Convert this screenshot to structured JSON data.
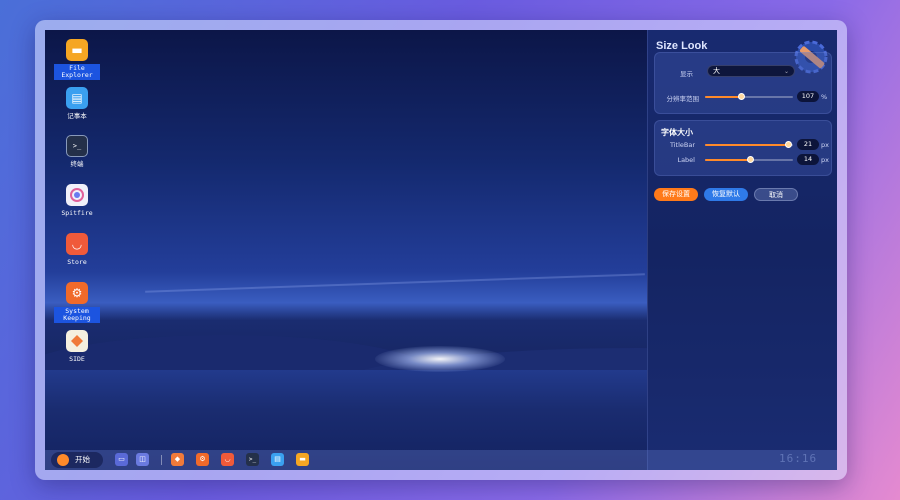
{
  "desktop": {
    "icons": [
      {
        "label": "File Explorer",
        "icon": "folder-icon",
        "color": "#f5a623"
      },
      {
        "label": "记事本",
        "icon": "notepad-icon",
        "color": "#3aa0f0"
      },
      {
        "label": "终端",
        "icon": "terminal-icon",
        "color": "#24304a"
      },
      {
        "label": "Spitfire",
        "icon": "browser-icon",
        "color": "#e8e8f8"
      },
      {
        "label": "Store",
        "icon": "store-icon",
        "color": "#f05a3a"
      },
      {
        "label": "System Keeping",
        "icon": "settings-icon",
        "color": "#f06a2a"
      },
      {
        "label": "SIDE",
        "icon": "ide-icon",
        "color": "#f5f0e0"
      }
    ]
  },
  "panel": {
    "title": "Size Look",
    "display_label": "显示",
    "display_value": "大",
    "resolution_label": "分辨率范围",
    "resolution_value": "107",
    "resolution_level": 0.42,
    "resolution_unit": "%",
    "font_section_title": "字体大小",
    "titlebar_label": "TitleBar",
    "titlebar_value": "21",
    "titlebar_level": 0.95,
    "label_label": "Label",
    "label_value": "14",
    "label_level": 0.52,
    "unit_px": "px",
    "save_button": "保存设置",
    "restore_button": "恢复默认",
    "cancel_button": "取消",
    "accent_color": "#ff8a2a",
    "save_color": "#ff7a1a",
    "restore_color": "#2f7ae8"
  },
  "taskbar": {
    "start_label": "开始",
    "clock": "16:16"
  }
}
